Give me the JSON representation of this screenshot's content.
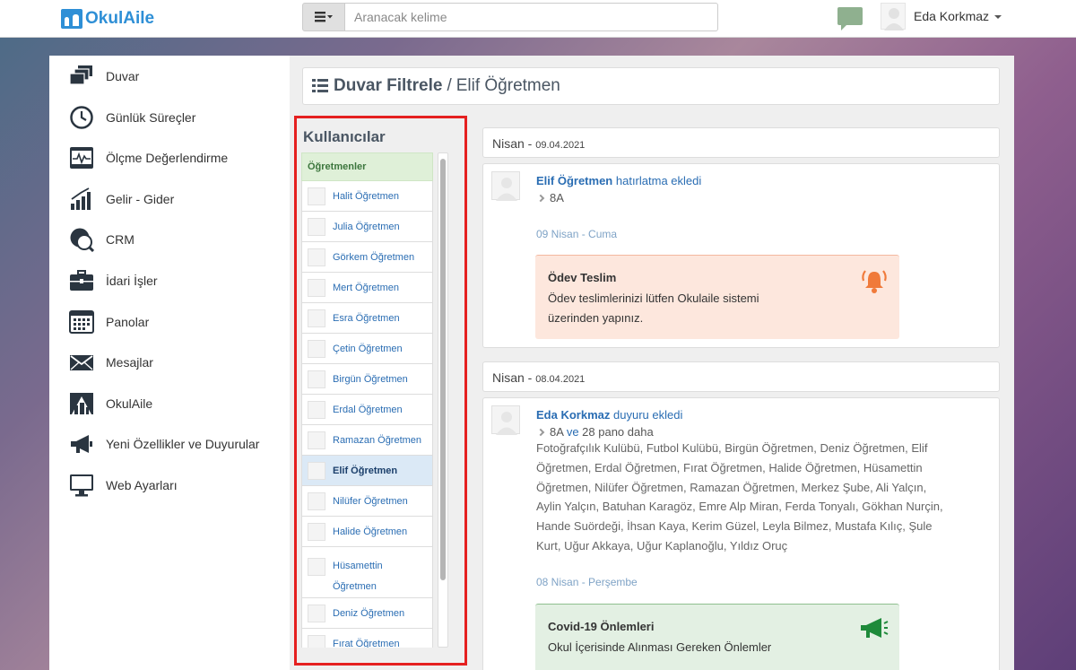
{
  "brand": {
    "name": "OkulAile"
  },
  "search": {
    "placeholder": "Aranacak kelime"
  },
  "user": {
    "name": "Eda Korkmaz"
  },
  "nav": [
    {
      "label": "Duvar",
      "icon": "wall-icon"
    },
    {
      "label": "Günlük Süreçler",
      "icon": "clock-icon"
    },
    {
      "label": "Ölçme Değerlendirme",
      "icon": "monitor-chart-icon"
    },
    {
      "label": "Gelir - Gider",
      "icon": "bar-chart-icon"
    },
    {
      "label": "CRM",
      "icon": "crm-chat-icon"
    },
    {
      "label": "İdari İşler",
      "icon": "briefcase-icon"
    },
    {
      "label": "Panolar",
      "icon": "calendar-board-icon"
    },
    {
      "label": "Mesajlar",
      "icon": "envelope-icon"
    },
    {
      "label": "OkulAile",
      "icon": "okulaile-logo-icon"
    },
    {
      "label": "Yeni Özellikler ve Duyurular",
      "icon": "megaphone-icon"
    },
    {
      "label": "Web Ayarları",
      "icon": "desktop-icon"
    }
  ],
  "header": {
    "title": "Duvar Filtrele",
    "separator": "/",
    "subtitle": "Elif Öğretmen"
  },
  "users": {
    "title": "Kullanıcılar",
    "group": "Öğretmenler",
    "items": [
      "Halit Öğretmen",
      "Julia Öğretmen",
      "Görkem Öğretmen",
      "Mert Öğretmen",
      "Esra Öğretmen",
      "Çetin Öğretmen",
      "Birgün Öğretmen",
      "Erdal Öğretmen",
      "Ramazan Öğretmen",
      "Elif Öğretmen",
      "Nilüfer Öğretmen",
      "Halide Öğretmen",
      "Hüsamettin Öğretmen",
      "Deniz Öğretmen",
      "Fırat Öğretmen"
    ],
    "active": "Elif Öğretmen"
  },
  "feed": [
    {
      "month": "Nisan -",
      "date": "09.04.2021",
      "author": "Elif Öğretmen",
      "action": "hatırlatma ekledi",
      "target": "8A",
      "event_date": "09 Nisan - Cuma",
      "notice_title": "Ödev Teslim",
      "notice_body_1": "Ödev teslimlerinizi lütfen Okulaile sistemi",
      "notice_body_2": "üzerinden yapınız.",
      "notice_icon": "alarm-bell-icon",
      "notice_color": "#f07a3a"
    },
    {
      "month": "Nisan -",
      "date": "08.04.2021",
      "author": "Eda Korkmaz",
      "action": "duyuru ekledi",
      "target": "8A",
      "target_more_link": "ve",
      "target_more": "28 pano daha",
      "recipients": "Fotoğrafçılık Kulübü, Futbol Kulübü, Birgün Öğretmen, Deniz Öğretmen, Elif Öğretmen, Erdal Öğretmen, Fırat Öğretmen, Halide Öğretmen, Hüsamettin Öğretmen, Nilüfer Öğretmen, Ramazan Öğretmen, Merkez Şube, Ali Yalçın, Aylin Yalçın, Batuhan Karagöz, Emre Alp Miran, Ferda Tonyalı, Gökhan Nurçin, Hande Suördeği, İhsan Kaya, Kerim Güzel, Leyla Bilmez, Mustafa Kılıç, Şule Kurt, Uğur Akkaya, Uğur Kaplanoğlu, Yıldız Oruç",
      "event_date": "08 Nisan - Perşembe",
      "notice_title": "Covid-19 Önlemleri",
      "notice_body_1": "Okul İçerisinde Alınması Gereken Önlemler",
      "notice_icon": "megaphone-icon",
      "notice_color": "#1e8a3a"
    }
  ]
}
